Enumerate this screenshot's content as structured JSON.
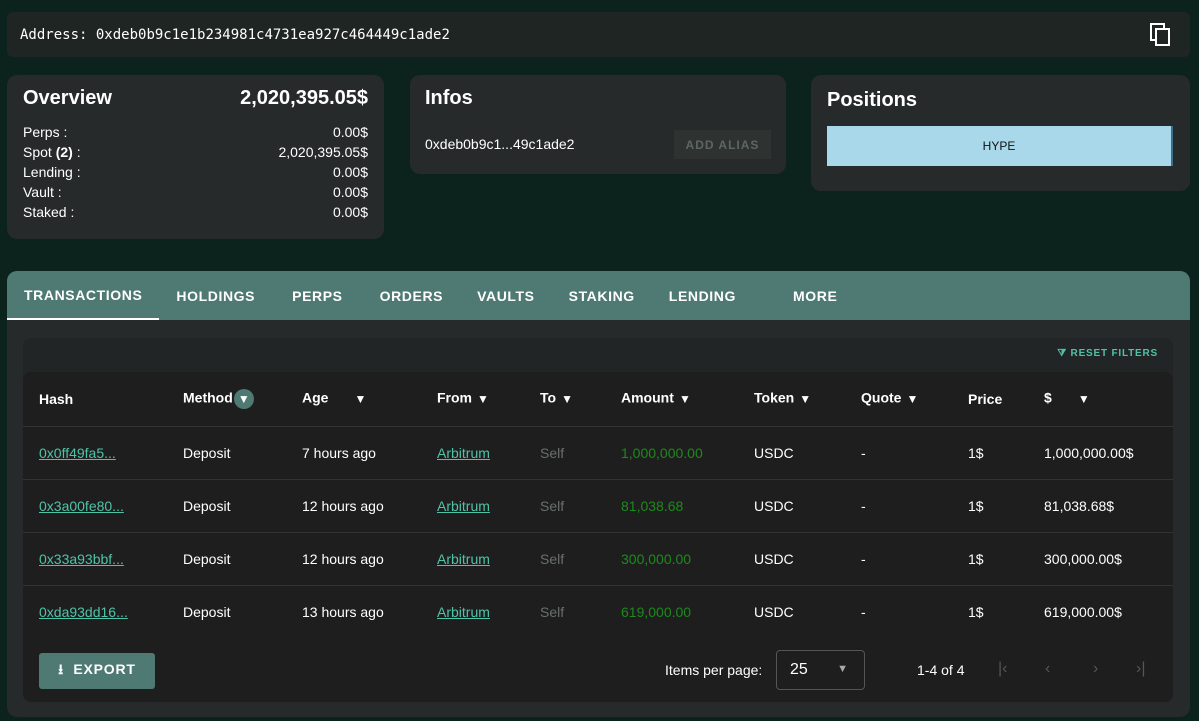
{
  "address": {
    "label": "Address:",
    "value": "0xdeb0b9c1e1b234981c4731ea927c464449c1ade2"
  },
  "overview": {
    "title": "Overview",
    "total": "2,020,395.05$",
    "rows": [
      {
        "label": "Perps :",
        "value": "0.00$"
      },
      {
        "label": "Spot",
        "count": "(2)",
        "suffix": " :",
        "value": "2,020,395.05$"
      },
      {
        "label": "Lending :",
        "value": "0.00$"
      },
      {
        "label": "Vault :",
        "value": "0.00$"
      },
      {
        "label": "Staked :",
        "value": "0.00$"
      }
    ]
  },
  "infos": {
    "title": "Infos",
    "short_address": "0xdeb0b9c1...49c1ade2",
    "add_alias": "ADD ALIAS"
  },
  "positions": {
    "title": "Positions",
    "items": [
      "HYPE"
    ]
  },
  "tabs": [
    "TRANSACTIONS",
    "HOLDINGS",
    "PERPS",
    "ORDERS",
    "VAULTS",
    "STAKING",
    "LENDING",
    "MORE"
  ],
  "reset_filters": "RESET FILTERS",
  "columns": [
    "Hash",
    "Method",
    "Age",
    "From",
    "To",
    "Amount",
    "Token",
    "Quote",
    "Price",
    "$"
  ],
  "rows": [
    [
      "0x0ff49fa5...",
      "Deposit",
      "7 hours ago",
      "Arbitrum",
      "Self",
      "1,000,000.00",
      "USDC",
      "-",
      "1$",
      "1,000,000.00$"
    ],
    [
      "0x3a00fe80...",
      "Deposit",
      "12 hours ago",
      "Arbitrum",
      "Self",
      "81,038.68",
      "USDC",
      "-",
      "1$",
      "81,038.68$"
    ],
    [
      "0x33a93bbf...",
      "Deposit",
      "12 hours ago",
      "Arbitrum",
      "Self",
      "300,000.00",
      "USDC",
      "-",
      "1$",
      "300,000.00$"
    ],
    [
      "0xda93dd16...",
      "Deposit",
      "13 hours ago",
      "Arbitrum",
      "Self",
      "619,000.00",
      "USDC",
      "-",
      "1$",
      "619,000.00$"
    ]
  ],
  "footer": {
    "export": "EXPORT",
    "items_per_page_label": "Items per page:",
    "items_per_page": "25",
    "range": "1-4 of 4"
  }
}
